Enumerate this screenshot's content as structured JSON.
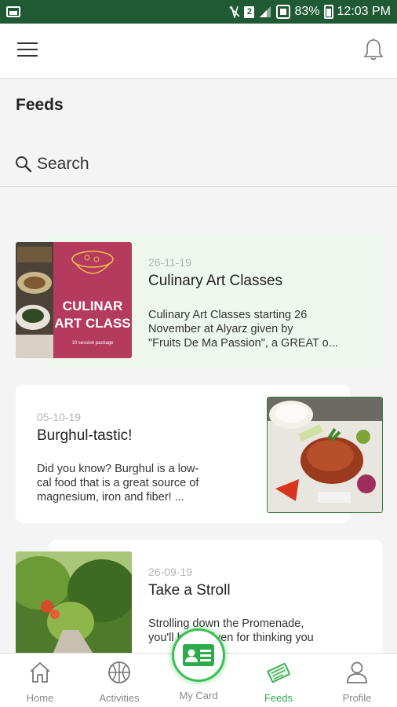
{
  "status_bar": {
    "sim_number": "2",
    "battery": "83%",
    "time": "12:03 PM"
  },
  "header": {
    "page_title": "Feeds"
  },
  "search": {
    "label": "Search"
  },
  "feeds": [
    {
      "date": "26-11-19",
      "title": "Culinary Art Classes",
      "description_lines": [
        "Culinary Art Classes starting 26",
        "November at Alyarz given by",
        "\"Fruits De Ma Passion\", a GREAT o..."
      ],
      "image_text_line1": "CULINAR",
      "image_text_line2": "ART CLASS",
      "image_caption": "10 session package"
    },
    {
      "date": "05-10-19",
      "title": "Burghul-tastic!",
      "description_lines": [
        "Did you know? Burghul is a low-",
        "cal food that is a great source of",
        "magnesium, iron and fiber! ..."
      ]
    },
    {
      "date": "26-09-19",
      "title": "Take a Stroll",
      "description_lines": [
        "Strolling down the Promenade,",
        "you'll be forgiven for thinking you"
      ]
    }
  ],
  "bottom_nav": {
    "items": [
      {
        "label": "Home",
        "icon": "home-icon"
      },
      {
        "label": "Activities",
        "icon": "basketball-icon"
      },
      {
        "label": "My Card",
        "icon": "id-card-icon"
      },
      {
        "label": "Feeds",
        "icon": "newspaper-icon"
      },
      {
        "label": "Profile",
        "icon": "person-icon"
      }
    ]
  },
  "colors": {
    "status_bar": "#1f5a34",
    "accent": "#2eaa4a",
    "highlight_card": "#eef7ee"
  }
}
